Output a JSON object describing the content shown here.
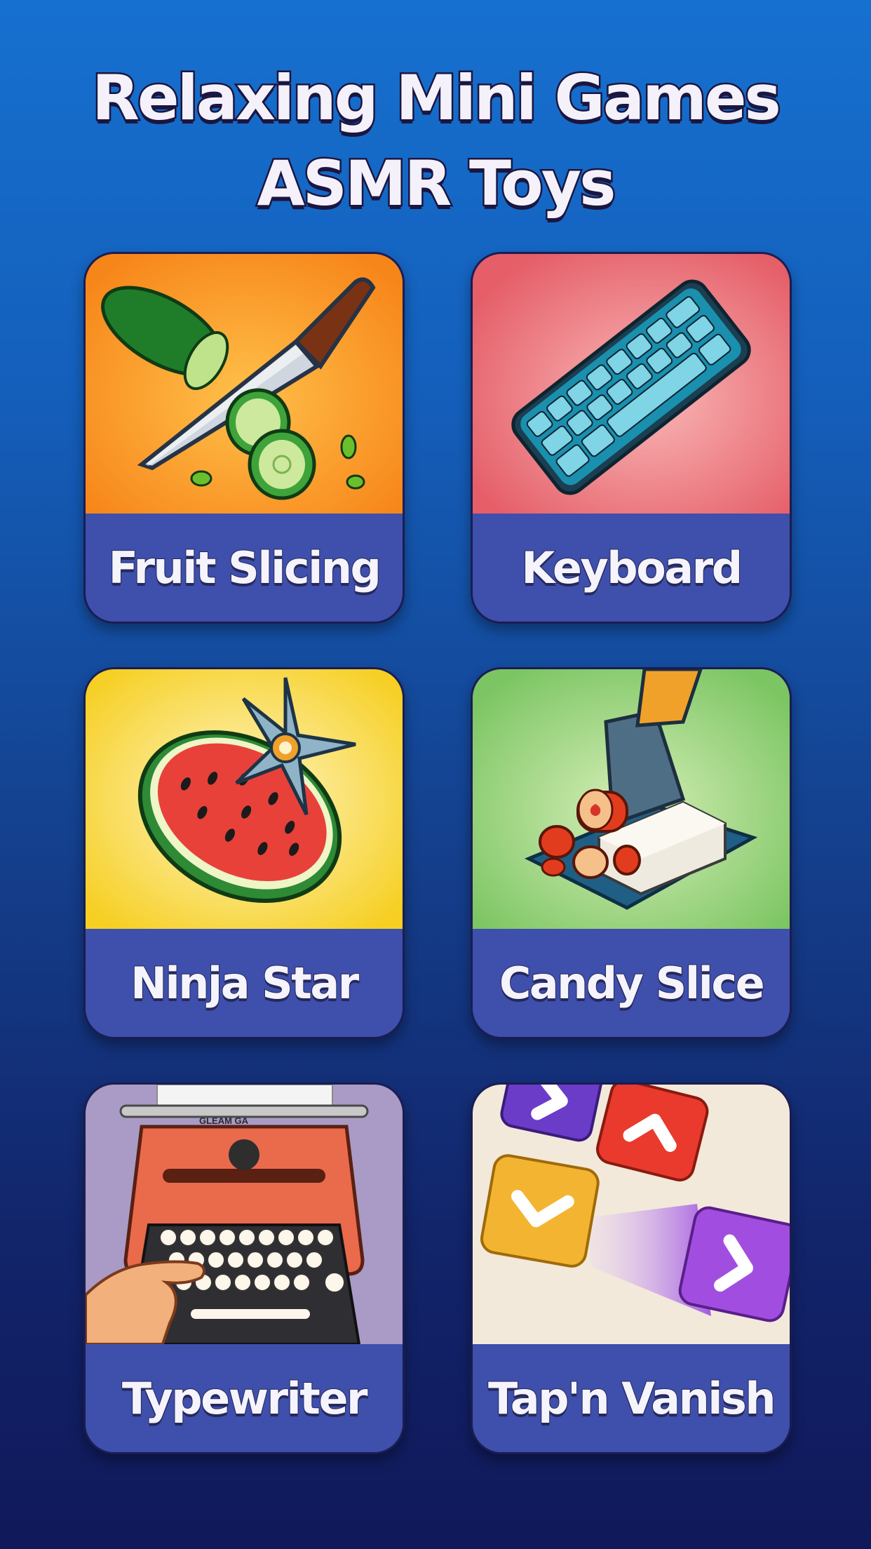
{
  "header": {
    "title_line1": "Relaxing Mini Games",
    "title_line2": "ASMR Toys"
  },
  "games": [
    {
      "label": "Fruit Slicing",
      "icon": "cucumber-knife-icon",
      "bg": "#f7921e"
    },
    {
      "label": "Keyboard",
      "icon": "keyboard-icon",
      "bg": "#e9656e"
    },
    {
      "label": "Ninja Star",
      "icon": "watermelon-shuriken-icon",
      "bg": "#f6d52a"
    },
    {
      "label": "Candy Slice",
      "icon": "knife-candy-icon",
      "bg": "#8ccc6e"
    },
    {
      "label": "Typewriter",
      "icon": "typewriter-icon",
      "bg": "#a89bc5",
      "brand_text": "GLEAM GA"
    },
    {
      "label": "Tap'n Vanish",
      "icon": "arrow-blocks-icon",
      "bg": "#f1e8d8"
    }
  ]
}
